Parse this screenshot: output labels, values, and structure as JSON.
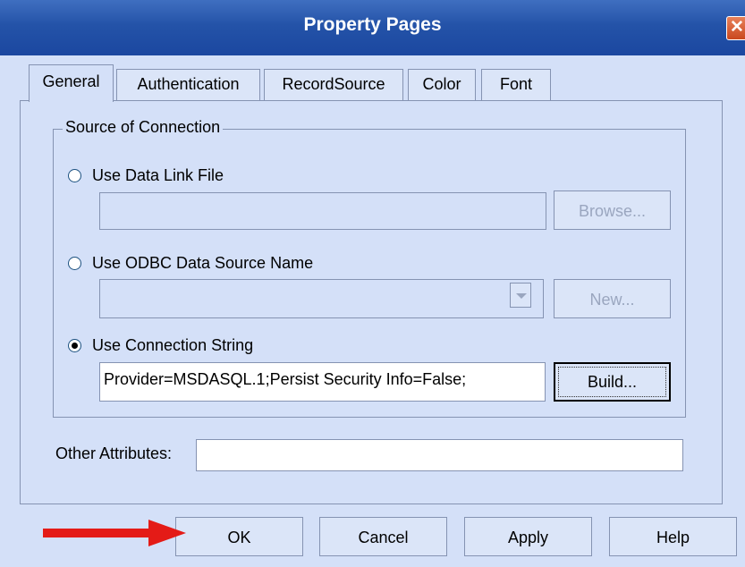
{
  "window": {
    "title": "Property Pages"
  },
  "tabs": [
    {
      "label": "General",
      "active": true
    },
    {
      "label": "Authentication",
      "active": false
    },
    {
      "label": "RecordSource",
      "active": false
    },
    {
      "label": "Color",
      "active": false
    },
    {
      "label": "Font",
      "active": false
    }
  ],
  "source_group": {
    "legend": "Source of Connection",
    "data_link": {
      "label": "Use Data Link File",
      "selected": false,
      "value": "",
      "browse_label": "Browse..."
    },
    "odbc": {
      "label": "Use ODBC Data Source Name",
      "selected": false,
      "value": "",
      "new_label": "New..."
    },
    "conn_string": {
      "label": "Use Connection String",
      "selected": true,
      "value": "Provider=MSDASQL.1;Persist Security Info=False;",
      "build_label": "Build..."
    }
  },
  "other_attributes": {
    "label": "Other Attributes:",
    "value": ""
  },
  "buttons": {
    "ok": "OK",
    "cancel": "Cancel",
    "apply": "Apply",
    "help": "Help"
  },
  "colors": {
    "accent_arrow": "#e41b17",
    "titlebar": "#2453a8",
    "background": "#d4e0f8"
  }
}
